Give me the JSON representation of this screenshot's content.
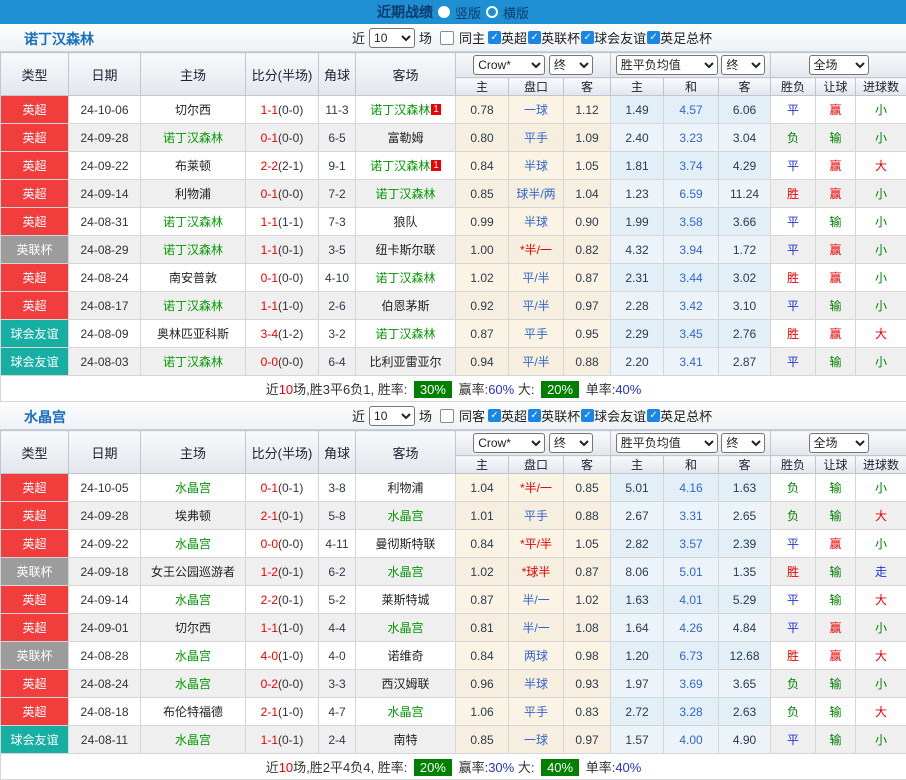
{
  "topbar": {
    "title": "近期战绩",
    "vertical_label": "竖版",
    "horizontal_label": "横版"
  },
  "table_header": {
    "main_cols": [
      "类型",
      "日期",
      "主场",
      "比分(半场)",
      "角球",
      "客场"
    ],
    "bookmaker_select": "Crow*",
    "final_select": "终",
    "avg_select": "胜平负均值",
    "scope_select": "全场",
    "sub_cols": [
      "主",
      "盘口",
      "客",
      "主",
      "和",
      "客",
      "胜负",
      "让球",
      "进球数"
    ]
  },
  "sections": [
    {
      "team": "诺丁汉森林",
      "filter": {
        "prefix": "近",
        "count": "10",
        "suffix": "场",
        "same_label": "同主",
        "same_checked": false,
        "leagues": [
          "英超",
          "英联杯",
          "球会友谊",
          "英足总杯"
        ]
      },
      "rows": [
        {
          "type": "英超",
          "date": "24-10-06",
          "home": {
            "name": "切尔西",
            "self": false
          },
          "score": "1-1",
          "half": "(0-0)",
          "corners": "11-3",
          "away": {
            "name": "诺丁汉森林",
            "self": true,
            "badge": "1"
          },
          "crow": [
            "0.78",
            "一球",
            "1.12"
          ],
          "avg": [
            "1.49",
            "4.57",
            "6.06"
          ],
          "results": [
            [
              "平",
              "blue"
            ],
            [
              "赢",
              "red"
            ],
            [
              "小",
              "green"
            ]
          ]
        },
        {
          "type": "英超",
          "date": "24-09-28",
          "home": {
            "name": "诺丁汉森林",
            "self": true
          },
          "score": "0-1",
          "half": "(0-0)",
          "corners": "6-5",
          "away": {
            "name": "富勒姆",
            "self": false
          },
          "crow": [
            "0.80",
            "平手",
            "1.09"
          ],
          "avg": [
            "2.40",
            "3.23",
            "3.04"
          ],
          "results": [
            [
              "负",
              "green"
            ],
            [
              "输",
              "green"
            ],
            [
              "小",
              "green"
            ]
          ]
        },
        {
          "type": "英超",
          "date": "24-09-22",
          "home": {
            "name": "布莱顿",
            "self": false
          },
          "score": "2-2",
          "half": "(2-1)",
          "corners": "9-1",
          "away": {
            "name": "诺丁汉森林",
            "self": true,
            "badge": "1"
          },
          "crow": [
            "0.84",
            "半球",
            "1.05"
          ],
          "avg": [
            "1.81",
            "3.74",
            "4.29"
          ],
          "results": [
            [
              "平",
              "blue"
            ],
            [
              "赢",
              "red"
            ],
            [
              "大",
              "red"
            ]
          ]
        },
        {
          "type": "英超",
          "date": "24-09-14",
          "home": {
            "name": "利物浦",
            "self": false
          },
          "score": "0-1",
          "half": "(0-0)",
          "corners": "7-2",
          "away": {
            "name": "诺丁汉森林",
            "self": true
          },
          "crow": [
            "0.85",
            "球半/两",
            "1.04"
          ],
          "avg": [
            "1.23",
            "6.59",
            "11.24"
          ],
          "results": [
            [
              "胜",
              "red"
            ],
            [
              "赢",
              "red"
            ],
            [
              "小",
              "green"
            ]
          ]
        },
        {
          "type": "英超",
          "date": "24-08-31",
          "home": {
            "name": "诺丁汉森林",
            "self": true
          },
          "score": "1-1",
          "half": "(1-1)",
          "corners": "7-3",
          "away": {
            "name": "狼队",
            "self": false
          },
          "crow": [
            "0.99",
            "半球",
            "0.90"
          ],
          "avg": [
            "1.99",
            "3.58",
            "3.66"
          ],
          "results": [
            [
              "平",
              "blue"
            ],
            [
              "输",
              "green"
            ],
            [
              "小",
              "green"
            ]
          ]
        },
        {
          "type": "英联杯",
          "date": "24-08-29",
          "home": {
            "name": "诺丁汉森林",
            "self": true
          },
          "score": "1-1",
          "half": "(0-1)",
          "corners": "3-5",
          "away": {
            "name": "纽卡斯尔联",
            "self": false
          },
          "crow": [
            "1.00",
            "*半/一",
            "0.82"
          ],
          "avg": [
            "4.32",
            "3.94",
            "1.72"
          ],
          "results": [
            [
              "平",
              "blue"
            ],
            [
              "赢",
              "red"
            ],
            [
              "小",
              "green"
            ]
          ]
        },
        {
          "type": "英超",
          "date": "24-08-24",
          "home": {
            "name": "南安普敦",
            "self": false
          },
          "score": "0-1",
          "half": "(0-0)",
          "corners": "4-10",
          "away": {
            "name": "诺丁汉森林",
            "self": true
          },
          "crow": [
            "1.02",
            "平/半",
            "0.87"
          ],
          "avg": [
            "2.31",
            "3.44",
            "3.02"
          ],
          "results": [
            [
              "胜",
              "red"
            ],
            [
              "赢",
              "red"
            ],
            [
              "小",
              "green"
            ]
          ]
        },
        {
          "type": "英超",
          "date": "24-08-17",
          "home": {
            "name": "诺丁汉森林",
            "self": true
          },
          "score": "1-1",
          "half": "(1-0)",
          "corners": "2-6",
          "away": {
            "name": "伯恩茅斯",
            "self": false
          },
          "crow": [
            "0.92",
            "平/半",
            "0.97"
          ],
          "avg": [
            "2.28",
            "3.42",
            "3.10"
          ],
          "results": [
            [
              "平",
              "blue"
            ],
            [
              "输",
              "green"
            ],
            [
              "小",
              "green"
            ]
          ]
        },
        {
          "type": "球会友谊",
          "date": "24-08-09",
          "home": {
            "name": "奥林匹亚科斯",
            "self": false
          },
          "score": "3-4",
          "half": "(1-2)",
          "corners": "3-2",
          "away": {
            "name": "诺丁汉森林",
            "self": true
          },
          "crow": [
            "0.87",
            "平手",
            "0.95"
          ],
          "avg": [
            "2.29",
            "3.45",
            "2.76"
          ],
          "results": [
            [
              "胜",
              "red"
            ],
            [
              "赢",
              "red"
            ],
            [
              "大",
              "red"
            ]
          ]
        },
        {
          "type": "球会友谊",
          "date": "24-08-03",
          "home": {
            "name": "诺丁汉森林",
            "self": true
          },
          "score": "0-0",
          "half": "(0-0)",
          "corners": "6-4",
          "away": {
            "name": "比利亚雷亚尔",
            "self": false
          },
          "crow": [
            "0.94",
            "平/半",
            "0.88"
          ],
          "avg": [
            "2.20",
            "3.41",
            "2.87"
          ],
          "results": [
            [
              "平",
              "blue"
            ],
            [
              "输",
              "green"
            ],
            [
              "小",
              "green"
            ]
          ]
        }
      ],
      "summary": [
        {
          "t": "近",
          "c": "dark"
        },
        {
          "t": "10",
          "c": "red"
        },
        {
          "t": "场,胜3平6负1, 胜率: ",
          "c": "dark"
        },
        {
          "t": "30%",
          "box": true
        },
        {
          "t": " 赢率:",
          "c": "dark"
        },
        {
          "t": "60%",
          "c": "blue"
        },
        {
          "t": " 大: ",
          "c": "dark"
        },
        {
          "t": "20%",
          "box": true
        },
        {
          "t": " 单率:",
          "c": "dark"
        },
        {
          "t": "40%",
          "c": "blue"
        }
      ]
    },
    {
      "team": "水晶宫",
      "filter": {
        "prefix": "近",
        "count": "10",
        "suffix": "场",
        "same_label": "同客",
        "same_checked": false,
        "leagues": [
          "英超",
          "英联杯",
          "球会友谊",
          "英足总杯"
        ]
      },
      "rows": [
        {
          "type": "英超",
          "date": "24-10-05",
          "home": {
            "name": "水晶宫",
            "self": true
          },
          "score": "0-1",
          "half": "(0-1)",
          "corners": "3-8",
          "away": {
            "name": "利物浦",
            "self": false
          },
          "crow": [
            "1.04",
            "*半/一",
            "0.85"
          ],
          "avg": [
            "5.01",
            "4.16",
            "1.63"
          ],
          "results": [
            [
              "负",
              "green"
            ],
            [
              "输",
              "green"
            ],
            [
              "小",
              "green"
            ]
          ]
        },
        {
          "type": "英超",
          "date": "24-09-28",
          "home": {
            "name": "埃弗顿",
            "self": false
          },
          "score": "2-1",
          "half": "(0-1)",
          "corners": "5-8",
          "away": {
            "name": "水晶宫",
            "self": true
          },
          "crow": [
            "1.01",
            "平手",
            "0.88"
          ],
          "avg": [
            "2.67",
            "3.31",
            "2.65"
          ],
          "results": [
            [
              "负",
              "green"
            ],
            [
              "输",
              "green"
            ],
            [
              "大",
              "red"
            ]
          ]
        },
        {
          "type": "英超",
          "date": "24-09-22",
          "home": {
            "name": "水晶宫",
            "self": true
          },
          "score": "0-0",
          "half": "(0-0)",
          "corners": "4-11",
          "away": {
            "name": "曼彻斯特联",
            "self": false
          },
          "crow": [
            "0.84",
            "*平/半",
            "1.05"
          ],
          "avg": [
            "2.82",
            "3.57",
            "2.39"
          ],
          "results": [
            [
              "平",
              "blue"
            ],
            [
              "赢",
              "red"
            ],
            [
              "小",
              "green"
            ]
          ]
        },
        {
          "type": "英联杯",
          "date": "24-09-18",
          "home": {
            "name": "女王公园巡游者",
            "self": false
          },
          "score": "1-2",
          "half": "(0-1)",
          "corners": "6-2",
          "away": {
            "name": "水晶宫",
            "self": true
          },
          "crow": [
            "1.02",
            "*球半",
            "0.87"
          ],
          "avg": [
            "8.06",
            "5.01",
            "1.35"
          ],
          "results": [
            [
              "胜",
              "red"
            ],
            [
              "输",
              "green"
            ],
            [
              "走",
              "blue"
            ]
          ]
        },
        {
          "type": "英超",
          "date": "24-09-14",
          "home": {
            "name": "水晶宫",
            "self": true
          },
          "score": "2-2",
          "half": "(0-1)",
          "corners": "5-2",
          "away": {
            "name": "莱斯特城",
            "self": false
          },
          "crow": [
            "0.87",
            "半/一",
            "1.02"
          ],
          "avg": [
            "1.63",
            "4.01",
            "5.29"
          ],
          "results": [
            [
              "平",
              "blue"
            ],
            [
              "输",
              "green"
            ],
            [
              "大",
              "red"
            ]
          ]
        },
        {
          "type": "英超",
          "date": "24-09-01",
          "home": {
            "name": "切尔西",
            "self": false
          },
          "score": "1-1",
          "half": "(1-0)",
          "corners": "4-4",
          "away": {
            "name": "水晶宫",
            "self": true
          },
          "crow": [
            "0.81",
            "半/一",
            "1.08"
          ],
          "avg": [
            "1.64",
            "4.26",
            "4.84"
          ],
          "results": [
            [
              "平",
              "blue"
            ],
            [
              "赢",
              "red"
            ],
            [
              "小",
              "green"
            ]
          ]
        },
        {
          "type": "英联杯",
          "date": "24-08-28",
          "home": {
            "name": "水晶宫",
            "self": true
          },
          "score": "4-0",
          "half": "(1-0)",
          "corners": "4-0",
          "away": {
            "name": "诺维奇",
            "self": false
          },
          "crow": [
            "0.84",
            "两球",
            "0.98"
          ],
          "avg": [
            "1.20",
            "6.73",
            "12.68"
          ],
          "results": [
            [
              "胜",
              "red"
            ],
            [
              "赢",
              "red"
            ],
            [
              "大",
              "red"
            ]
          ]
        },
        {
          "type": "英超",
          "date": "24-08-24",
          "home": {
            "name": "水晶宫",
            "self": true
          },
          "score": "0-2",
          "half": "(0-0)",
          "corners": "3-3",
          "away": {
            "name": "西汉姆联",
            "self": false
          },
          "crow": [
            "0.96",
            "半球",
            "0.93"
          ],
          "avg": [
            "1.97",
            "3.69",
            "3.65"
          ],
          "results": [
            [
              "负",
              "green"
            ],
            [
              "输",
              "green"
            ],
            [
              "小",
              "green"
            ]
          ]
        },
        {
          "type": "英超",
          "date": "24-08-18",
          "home": {
            "name": "布伦特福德",
            "self": false
          },
          "score": "2-1",
          "half": "(1-0)",
          "corners": "4-7",
          "away": {
            "name": "水晶宫",
            "self": true
          },
          "crow": [
            "1.06",
            "平手",
            "0.83"
          ],
          "avg": [
            "2.72",
            "3.28",
            "2.63"
          ],
          "results": [
            [
              "负",
              "green"
            ],
            [
              "输",
              "green"
            ],
            [
              "大",
              "red"
            ]
          ]
        },
        {
          "type": "球会友谊",
          "date": "24-08-11",
          "home": {
            "name": "水晶宫",
            "self": true
          },
          "score": "1-1",
          "half": "(0-1)",
          "corners": "2-4",
          "away": {
            "name": "南特",
            "self": false
          },
          "crow": [
            "0.85",
            "一球",
            "0.97"
          ],
          "avg": [
            "1.57",
            "4.00",
            "4.90"
          ],
          "results": [
            [
              "平",
              "blue"
            ],
            [
              "输",
              "green"
            ],
            [
              "小",
              "green"
            ]
          ]
        }
      ],
      "summary": [
        {
          "t": "近",
          "c": "dark"
        },
        {
          "t": "10",
          "c": "red"
        },
        {
          "t": "场,胜2平4负4, 胜率: ",
          "c": "dark"
        },
        {
          "t": "20%",
          "box": true
        },
        {
          "t": " 赢率:",
          "c": "dark"
        },
        {
          "t": "30%",
          "c": "blue"
        },
        {
          "t": " 大: ",
          "c": "dark"
        },
        {
          "t": "40%",
          "box": true
        },
        {
          "t": " 单率:",
          "c": "dark"
        },
        {
          "t": "40%",
          "c": "blue"
        }
      ]
    }
  ]
}
